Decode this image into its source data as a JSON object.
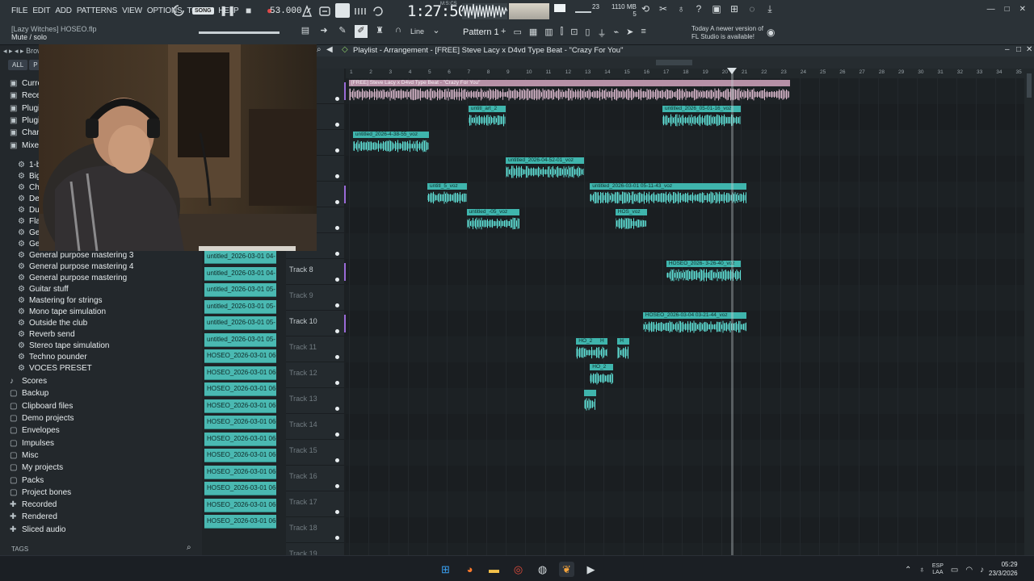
{
  "menu": [
    "FILE",
    "EDIT",
    "ADD",
    "PATTERNS",
    "VIEW",
    "OPTIONS",
    "TOOLS",
    "HELP"
  ],
  "project_hint": {
    "title": "[Lazy Witches] HOSEO.flp",
    "subtitle": "Mute / solo"
  },
  "transport": {
    "song_label": "SONG",
    "tempo": "53.000",
    "time": "1:27:50",
    "time_unit": "M:S:CS"
  },
  "cpu_value": "23",
  "memory": {
    "line1": "1110 MB",
    "line2": "5"
  },
  "toolbar": {
    "snap": "Line",
    "pattern": "Pattern 1"
  },
  "news": {
    "line1": "Today  A newer version of",
    "line2": "FL Studio is available!"
  },
  "browser": {
    "tabs": [
      "ALL",
      "P"
    ],
    "top_items": [
      {
        "icon": "folder-icon",
        "label": "Curre"
      },
      {
        "icon": "folder-icon",
        "label": "Recen"
      },
      {
        "icon": "folder-icon",
        "label": "Plugin"
      },
      {
        "icon": "folder-icon",
        "label": "Plugin"
      },
      {
        "icon": "folder-icon",
        "label": "Chann"
      },
      {
        "icon": "folder-icon",
        "label": "Mixer"
      }
    ],
    "mixer_partial": [
      "1-b",
      "Big",
      "Chc",
      "Def",
      "Dua",
      "Flai",
      "Ger",
      "Ger"
    ],
    "mixer_presets": [
      "General purpose mastering 3",
      "General purpose mastering 4",
      "General purpose mastering",
      "Guitar stuff",
      "Mastering for strings",
      "Mono tape simulation",
      "Outside the club",
      "Reverb send",
      "Stereo tape simulation",
      "Techno pounder",
      "VOCES PRESET"
    ],
    "folders": [
      {
        "icon": "note-icon",
        "label": "Scores"
      },
      {
        "icon": "folder-icon",
        "label": "Backup"
      },
      {
        "icon": "folder-icon",
        "label": "Clipboard files"
      },
      {
        "icon": "folder-icon",
        "label": "Demo projects"
      },
      {
        "icon": "folder-icon",
        "label": "Envelopes"
      },
      {
        "icon": "folder-icon",
        "label": "Impulses"
      },
      {
        "icon": "folder-icon",
        "label": "Misc"
      },
      {
        "icon": "folder-icon",
        "label": "My projects"
      },
      {
        "icon": "folder-icon",
        "label": "Packs"
      },
      {
        "icon": "folder-icon",
        "label": "Project bones"
      },
      {
        "icon": "plus-icon",
        "label": "Recorded"
      },
      {
        "icon": "plus-icon",
        "label": "Rendered"
      },
      {
        "icon": "plus-icon",
        "label": "Sliced audio"
      }
    ],
    "tags_label": "TAGS"
  },
  "clip_list": [
    "untitled_2026-03-01 04-",
    "untitled_2026-03-01 04-",
    "untitled_2026-03-01 05-",
    "untitled_2026-03-01 05-",
    "untitled_2026-03-01 05-",
    "untitled_2026-03-01 05-",
    "HOSEO_2026-03-01 06-4",
    "HOSEO_2026-03-01 06-4",
    "HOSEO_2026-03-01 06-4",
    "HOSEO_2026-03-01 06-4",
    "HOSEO_2026-03-01 06-4",
    "HOSEO_2026-03-01 06-4",
    "HOSEO_2026-03-01 06-4",
    "HOSEO_2026-03-01 06-5",
    "HOSEO_2026-03-01 06-5",
    "HOSEO_2026-03-01 06-5",
    "HOSEO_2026-03-01 06-5"
  ],
  "playlist": {
    "title": "Playlist - Arrangement - [FREE] Steve Lacy x D4vd Type Beat - \"Crazy For You\"",
    "ruler": [
      "1",
      "2",
      "3",
      "4",
      "5",
      "6",
      "7",
      "8",
      "9",
      "10",
      "11",
      "12",
      "13",
      "14",
      "15",
      "16",
      "17",
      "18",
      "19",
      "20",
      "21",
      "22",
      "23",
      "24",
      "25",
      "26",
      "27",
      "28",
      "29",
      "30",
      "31",
      "32",
      "33",
      "34",
      "35"
    ],
    "tracks": [
      {
        "name": "",
        "active": true
      },
      {
        "name": "",
        "active": false
      },
      {
        "name": "",
        "active": false
      },
      {
        "name": "",
        "active": false
      },
      {
        "name": "",
        "active": true
      },
      {
        "name": "",
        "active": false
      },
      {
        "name": "",
        "active": false
      },
      {
        "name": "Track 8",
        "active": true
      },
      {
        "name": "Track 9",
        "active": false
      },
      {
        "name": "Track 10",
        "active": true
      },
      {
        "name": "Track 11",
        "active": false
      },
      {
        "name": "Track 12",
        "active": false
      },
      {
        "name": "Track 13",
        "active": false
      },
      {
        "name": "Track 14",
        "active": false
      },
      {
        "name": "Track 15",
        "active": false
      },
      {
        "name": "Track 16",
        "active": false
      },
      {
        "name": "Track 17",
        "active": false
      },
      {
        "name": "Track 18",
        "active": false
      },
      {
        "name": "Track 19",
        "active": false
      }
    ],
    "clips": [
      {
        "track": 1,
        "start": 1,
        "end": 23.5,
        "label": "[FREE] Steve Lacy x D4vd Type Beat - \"Crazy For You\"",
        "color": "pink"
      },
      {
        "track": 2,
        "start": 7.1,
        "end": 9,
        "label": "untitl_art_2",
        "color": "teal"
      },
      {
        "track": 2,
        "start": 17,
        "end": 21,
        "label": "untitled_2026_05-01-16_voz",
        "color": "teal"
      },
      {
        "track": 3,
        "start": 1.2,
        "end": 5.1,
        "label": "untitled_2026-4-38-55_voz",
        "color": "teal"
      },
      {
        "track": 4,
        "start": 9,
        "end": 13,
        "label": "untitled_2026-04-52-01_voz",
        "color": "teal"
      },
      {
        "track": 5,
        "start": 5,
        "end": 7,
        "label": "untitl_5_voz",
        "color": "teal"
      },
      {
        "track": 5,
        "start": 13.3,
        "end": 21.3,
        "label": "untitled_2026-03-01 05-11-43_voz",
        "color": "teal"
      },
      {
        "track": 6,
        "start": 7,
        "end": 9.7,
        "label": "untitled_-05_voz",
        "color": "teal"
      },
      {
        "track": 6,
        "start": 14.6,
        "end": 16.2,
        "label": "HOS_voz",
        "color": "teal"
      },
      {
        "track": 8,
        "start": 17.2,
        "end": 21,
        "label": "HOSEO_2026- 3-26-40_voz",
        "color": "teal"
      },
      {
        "track": 10,
        "start": 16,
        "end": 21.3,
        "label": "HOSEO_2026-03-04 03-21-44_voz",
        "color": "teal"
      },
      {
        "track": 11,
        "start": 12.6,
        "end": 13.8,
        "label": "HO_2",
        "color": "teal"
      },
      {
        "track": 11,
        "start": 13.7,
        "end": 14.2,
        "label": "H",
        "color": "teal"
      },
      {
        "track": 11,
        "start": 14.7,
        "end": 15.3,
        "label": "H",
        "color": "teal"
      },
      {
        "track": 12,
        "start": 13.3,
        "end": 14.5,
        "label": "HO_2",
        "color": "teal"
      },
      {
        "track": 13,
        "start": 13,
        "end": 13.6,
        "label": "",
        "color": "teal"
      }
    ],
    "playhead_bar": 20.5
  },
  "taskbar": {
    "apps": [
      "windows-start-icon",
      "firefox-icon",
      "file-explorer-icon",
      "chrome-icon",
      "obs-icon",
      "fl-studio-icon",
      "media-player-icon"
    ],
    "lang": {
      "line1": "ESP",
      "line2": "LAA"
    },
    "time": "05:29",
    "date": "23/3/2026"
  }
}
